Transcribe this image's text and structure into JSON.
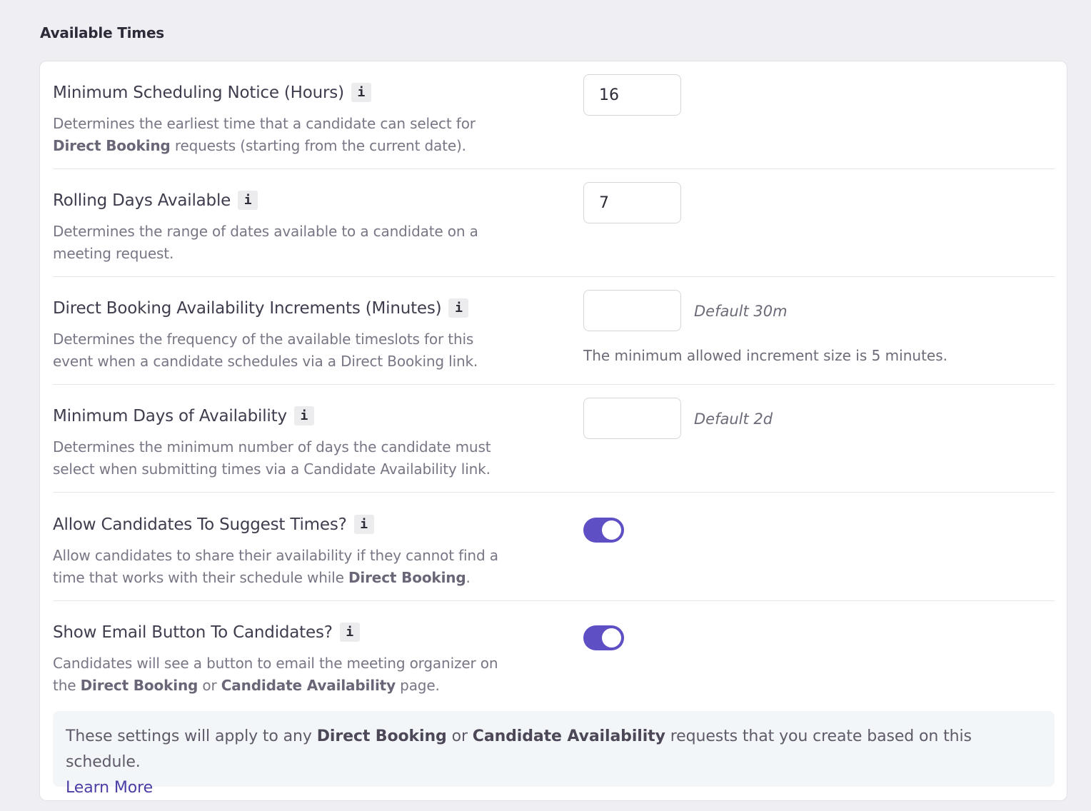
{
  "section": {
    "title": "Available Times"
  },
  "info_glyph": "i",
  "rows": {
    "min_notice": {
      "label": "Minimum Scheduling Notice (Hours)",
      "desc_part1": "Determines the earliest time that a candidate can select for ",
      "desc_bold1": "Direct Booking",
      "desc_part2": " requests (starting from the current date).",
      "value": "16"
    },
    "rolling_days": {
      "label": "Rolling Days Available",
      "desc_part1": "Determines the range of dates available to a candidate on a meeting request.",
      "value": "7"
    },
    "increments": {
      "label": "Direct Booking Availability Increments (Minutes)",
      "desc_part1": "Determines the frequency of the available timeslots for this event when a candidate schedules via a Direct Booking link.",
      "value": "",
      "default_hint": "Default 30m",
      "hint": "The minimum allowed increment size is 5 minutes."
    },
    "min_days": {
      "label": "Minimum Days of Availability",
      "desc_part1": "Determines the minimum number of days the candidate must select when submitting times via a Candidate Availability link.",
      "value": "",
      "default_hint": "Default 2d"
    },
    "suggest_times": {
      "label": "Allow Candidates To Suggest Times?",
      "desc_part1": "Allow candidates to share their availability if they cannot find a time that works with their schedule while ",
      "desc_bold1": "Direct Booking",
      "desc_part2": ".",
      "enabled": true
    },
    "email_button": {
      "label": "Show Email Button To Candidates?",
      "desc_part1": "Candidates will see a button to email the meeting organizer on the ",
      "desc_bold1": "Direct Booking",
      "desc_part2": " or ",
      "desc_bold2": "Candidate Availability",
      "desc_part3": " page.",
      "enabled": true
    }
  },
  "notice": {
    "part1": "These settings will apply to any ",
    "bold1": "Direct Booking",
    "part2": " or ",
    "bold2": "Candidate Availability",
    "part3": " requests that you create based on this schedule.",
    "link": "Learn More"
  },
  "colors": {
    "page_bg": "#efeef3",
    "card_bg": "#ffffff",
    "toggle_on": "#5e4fc4",
    "link": "#4a3ea6"
  }
}
